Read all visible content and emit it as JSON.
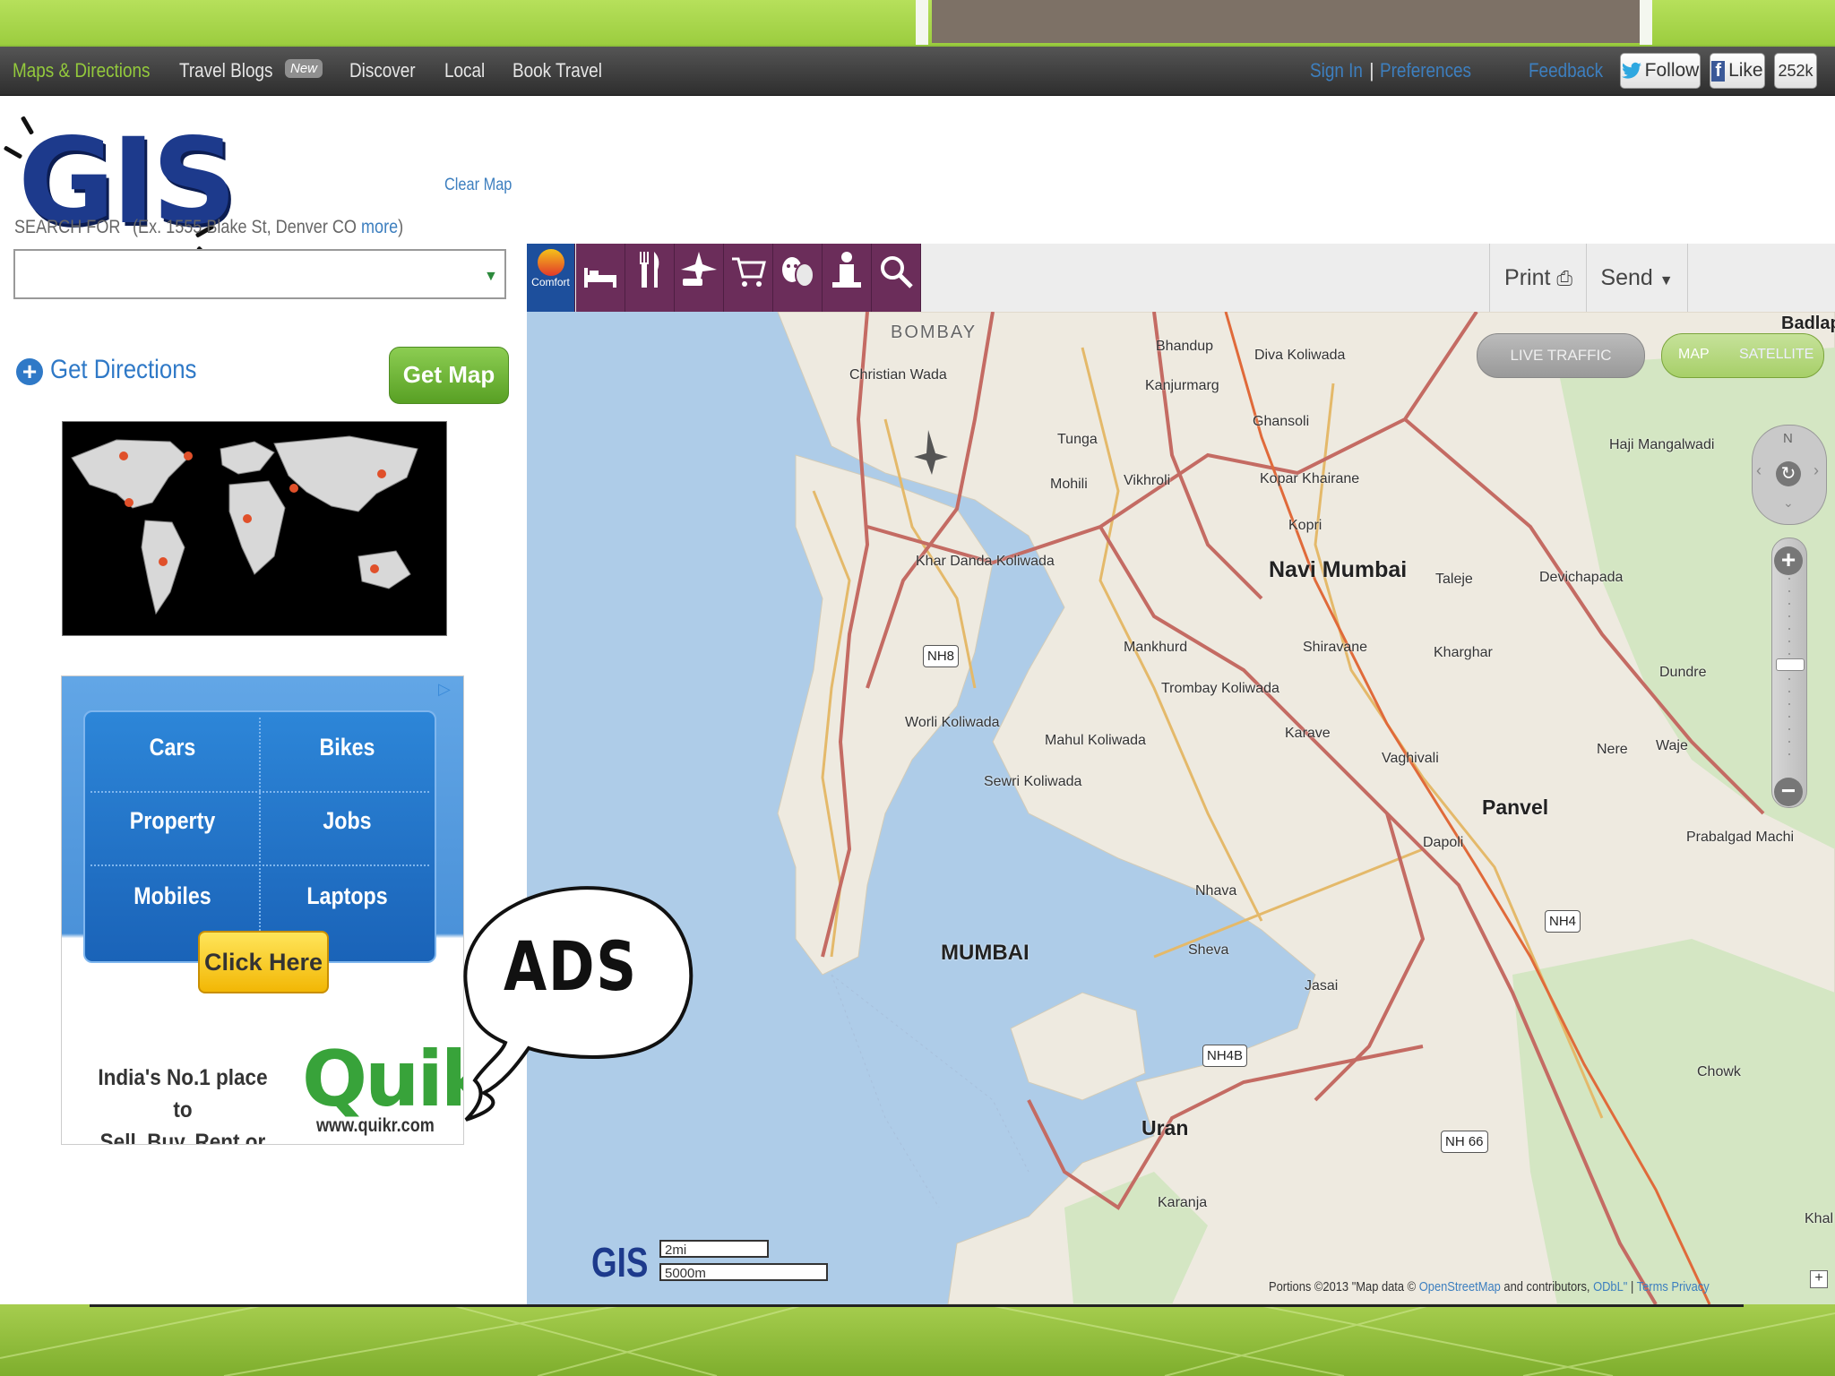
{
  "navbar": {
    "items": [
      "Maps & Directions",
      "Travel Blogs",
      "Discover",
      "Local",
      "Book Travel"
    ],
    "badge": "New",
    "sign_in": "Sign In",
    "sep": "|",
    "preferences": "Preferences",
    "feedback": "Feedback",
    "follow": "Follow",
    "like": "Like",
    "like_count": "252k"
  },
  "logo": "GIS",
  "left_panel": {
    "clear_map": "Clear Map",
    "search_label": "SEARCH FOR",
    "search_hint": "(Ex. 1555 Blake St, Denver CO",
    "search_more": "more",
    "search_hint_end": ")",
    "search_value": "",
    "get_directions": "Get Directions",
    "get_map": "Get Map"
  },
  "ad": {
    "cells": [
      "Cars",
      "Bikes",
      "Property",
      "Jobs",
      "Mobiles",
      "Laptops"
    ],
    "click_here": "Click Here",
    "tagline_1": "India's No.1 place to",
    "tagline_2": "Sell, Buy, Rent or Find",
    "brand": "Quikr",
    "url": "www.quikr.com"
  },
  "bubble_text": "ADS",
  "toolbar": {
    "icons": [
      "comfort-inn-logo",
      "hotel-icon",
      "restaurant-icon",
      "travel-icon",
      "shopping-icon",
      "entertainment-icon",
      "attraction-icon",
      "search-icon"
    ],
    "brand_small": "Comfort",
    "print": "Print",
    "send": "Send"
  },
  "map": {
    "live_traffic": "LIVE TRAFFIC",
    "map_btn": "MAP",
    "satellite_btn": "SATELLITE",
    "compass_n": "N",
    "scale_logo": "GIS",
    "scale_mi": "2mi",
    "scale_m": "5000m",
    "attribution": "Portions ©2013 \"Map data ©",
    "attribution_link1": "OpenStreetMap",
    "attribution_mid": "and contributors,",
    "attribution_link2": "ODbL\"",
    "attribution_sep": "|",
    "attribution_terms": "Terms",
    "attribution_privacy": "Privacy",
    "labels": {
      "bombay": "BOMBAY",
      "badlap": "Badlap",
      "christian_wada": "Christian Wada",
      "bhandup": "Bhandup",
      "diva": "Diva Koliwada",
      "kanjurmarg": "Kanjurmarg",
      "ghansoli": "Ghansoli",
      "tunga": "Tunga",
      "haji": "Haji Mangalwadi",
      "mohili": "Mohili",
      "vikhroli": "Vikhroli",
      "kopar": "Kopar Khairane",
      "kopri": "Kopri",
      "khar": "Khar Danda Koliwada",
      "navi_mumbai": "Navi Mumbai",
      "taleje": "Taleje",
      "devichapada": "Devichapada",
      "mankhurd": "Mankhurd",
      "shiravane": "Shiravane",
      "kharghar": "Kharghar",
      "trombay": "Trombay Koliwada",
      "dundre": "Dundre",
      "worli": "Worli Koliwada",
      "karave": "Karave",
      "mahul": "Mahul Koliwada",
      "vaghivali": "Vaghivali",
      "nere": "Nere",
      "waje": "Waje",
      "sewri": "Sewri Koliwada",
      "panvel": "Panvel",
      "prabalgad": "Prabalgad Machi",
      "dapoli": "Dapoli",
      "nhava": "Nhava",
      "mumbai": "MUMBAI",
      "sheva": "Sheva",
      "jasai": "Jasai",
      "chowk": "Chowk",
      "uran": "Uran",
      "karanja": "Karanja",
      "khal": "Khal"
    },
    "shields": {
      "nh8": "NH8",
      "nh4": "NH4",
      "nh4b": "NH4B",
      "nh66": "NH 66"
    }
  }
}
